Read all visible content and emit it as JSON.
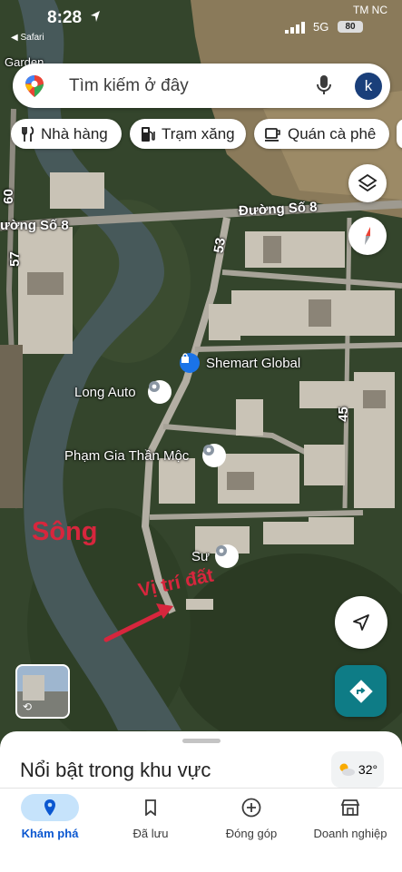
{
  "status_bar": {
    "time": "8:28",
    "back_app": "◀ Safari",
    "carrier": "TM NC",
    "network": "5G",
    "battery": "80"
  },
  "search": {
    "placeholder": "Tìm kiếm ở đây",
    "avatar_letter": "k"
  },
  "chips": [
    {
      "label": "Nhà hàng",
      "icon": "fork-knife-icon"
    },
    {
      "label": "Trạm xăng",
      "icon": "gas-station-icon"
    },
    {
      "label": "Quán cà phê",
      "icon": "coffee-cup-icon"
    }
  ],
  "map": {
    "roads": {
      "duong_so_8_left": "ường Số 8",
      "duong_so_8_right": "Đường Số 8",
      "road_53": "53",
      "road_45": "45",
      "road_57": "57",
      "road_60": "60"
    },
    "places": {
      "shemart": "Shemart Global",
      "long_auto": "Long Auto",
      "pham_gia": "Phạm Gia Thần Mộc",
      "su": "Sư",
      "garden": "Garden"
    },
    "annotations": {
      "river": "Sông",
      "land": "Vị trí đất"
    },
    "colors": {
      "annotation_red": "#d7263d",
      "directions_teal": "#0e7c86"
    }
  },
  "bottom_sheet": {
    "title": "Nổi bật trong khu vực",
    "temperature": "32°"
  },
  "tabs": [
    {
      "label": "Khám phá",
      "icon": "explore-pin-icon",
      "active": true
    },
    {
      "label": "Đã lưu",
      "icon": "bookmark-icon",
      "active": false
    },
    {
      "label": "Đóng góp",
      "icon": "add-circle-icon",
      "active": false
    },
    {
      "label": "Doanh nghiệp",
      "icon": "storefront-icon",
      "active": false
    }
  ]
}
